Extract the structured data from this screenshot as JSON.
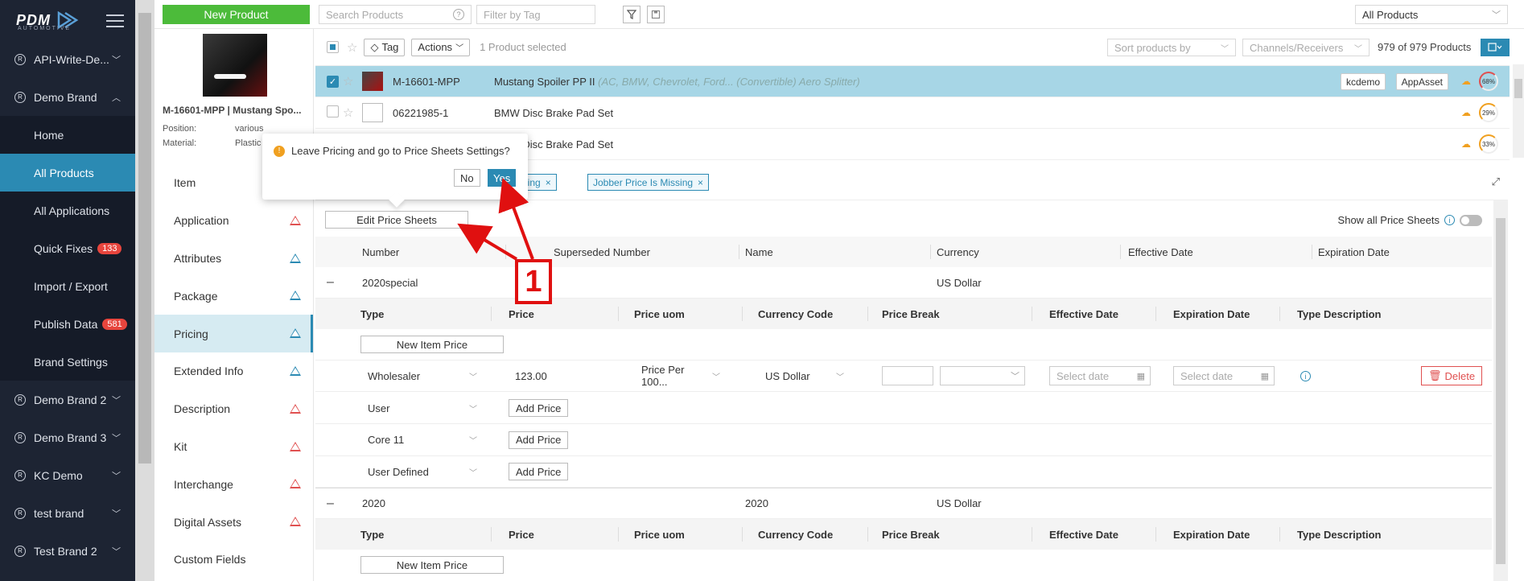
{
  "nav": {
    "logo": "PDM",
    "logo_sub": "AUTOMOTIVE",
    "items": [
      {
        "label": "API-Write-De...",
        "type": "brand"
      },
      {
        "label": "Demo Brand",
        "type": "brand",
        "open": true
      },
      {
        "label": "Home",
        "type": "sub"
      },
      {
        "label": "All Products",
        "type": "sub",
        "active": true
      },
      {
        "label": "All Applications",
        "type": "sub"
      },
      {
        "label": "Quick Fixes",
        "type": "sub",
        "badge": "133"
      },
      {
        "label": "Import / Export",
        "type": "sub"
      },
      {
        "label": "Publish Data",
        "type": "sub",
        "badge": "581"
      },
      {
        "label": "Brand Settings",
        "type": "sub"
      },
      {
        "label": "Demo Brand 2",
        "type": "brand"
      },
      {
        "label": "Demo Brand 3",
        "type": "brand"
      },
      {
        "label": "KC Demo",
        "type": "brand"
      },
      {
        "label": "test brand",
        "type": "brand"
      },
      {
        "label": "Test Brand 2",
        "type": "brand"
      }
    ]
  },
  "topbar": {
    "new_product": "New Product",
    "search_placeholder": "Search Products",
    "filter_tag_placeholder": "Filter by Tag",
    "all_products": "All Products"
  },
  "product": {
    "title": "M-16601-MPP | Mustang Spo...",
    "meta": [
      {
        "label": "Position:",
        "value": "various"
      },
      {
        "label": "Material:",
        "value": "Plastic"
      }
    ]
  },
  "list": {
    "tag_label": "Tag",
    "actions_label": "Actions",
    "selected_text": "1 Product selected",
    "sort_placeholder": "Sort products by",
    "channels_placeholder": "Channels/Receivers",
    "count": "979 of 979 Products",
    "rows": [
      {
        "number": "M-16601-MPP",
        "desc": "Mustang Spoiler PP II",
        "extra": "(AC, BMW, Chevrolet, Ford... (Convertible) Aero Splitter)",
        "selected": true,
        "tags": [
          "kcdemo",
          "AppAsset"
        ],
        "score": "68%"
      },
      {
        "number": "06221985-1",
        "desc": "BMW Disc Brake Pad Set",
        "extra": "",
        "selected": false,
        "tags": [],
        "score": "29%"
      },
      {
        "number": "",
        "desc": "BMW Disc Brake Pad Set",
        "extra": "",
        "selected": false,
        "tags": [],
        "score": "33%"
      }
    ]
  },
  "tabs": [
    {
      "label": "Item",
      "warn": ""
    },
    {
      "label": "Application",
      "warn": "red"
    },
    {
      "label": "Attributes",
      "warn": "blue"
    },
    {
      "label": "Package",
      "warn": "blue"
    },
    {
      "label": "Pricing",
      "warn": "blue",
      "active": true
    },
    {
      "label": "Extended Info",
      "warn": "blue"
    },
    {
      "label": "Description",
      "warn": "red"
    },
    {
      "label": "Kit",
      "warn": "red"
    },
    {
      "label": "Interchange",
      "warn": "red"
    },
    {
      "label": "Digital Assets",
      "warn": "red"
    },
    {
      "label": "Custom Fields",
      "warn": ""
    }
  ],
  "pricing": {
    "chips": [
      "Missing",
      "Jobber Price Is Missing"
    ],
    "edit_price_sheets": "Edit Price Sheets",
    "show_all": "Show all Price Sheets",
    "sheet_headers": [
      "Number",
      "Superseded Number",
      "Name",
      "Currency",
      "Effective Date",
      "Expiration Date"
    ],
    "item_headers": [
      "Type",
      "Price",
      "Price uom",
      "Currency Code",
      "Price Break",
      "Effective Date",
      "Expiration Date",
      "Type Description"
    ],
    "sheets": [
      {
        "number": "2020special",
        "name": "",
        "currency": "US Dollar"
      },
      {
        "number": "2020",
        "name": "2020",
        "currency": "US Dollar"
      }
    ],
    "new_item_price": "New Item Price",
    "wholesaler": {
      "type": "Wholesaler",
      "price": "123.00",
      "uom": "Price Per 100...",
      "currency": "US Dollar",
      "eff_placeholder": "Select date",
      "exp_placeholder": "Select date",
      "delete": "Delete"
    },
    "other_rows": [
      {
        "type": "User",
        "btn": "Add Price"
      },
      {
        "type": "Core 11",
        "btn": "Add Price"
      },
      {
        "type": "User Defined",
        "btn": "Add Price"
      }
    ]
  },
  "popconfirm": {
    "message": "Leave Pricing and go to Price Sheets Settings?",
    "no": "No",
    "yes": "Yes"
  },
  "annotation": {
    "label": "1",
    "color": "#e01010"
  },
  "colors": {
    "accent": "#2b8ab3",
    "new_button": "#4cbb3a",
    "nav_bg": "#1d2433",
    "warn_red": "#e05050"
  }
}
